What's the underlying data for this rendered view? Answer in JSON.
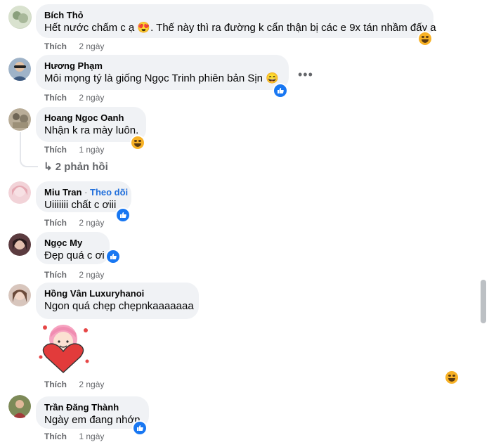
{
  "comments": [
    {
      "name": "Bích Thỏ",
      "follow": "",
      "text": "Hết nước chấm c ạ 😍. Thế này thì ra đường k cẩn thận bị các e 9x tán nhầm đấy a",
      "like": "Thích",
      "time": "2 ngày",
      "reaction": "haha"
    },
    {
      "name": "Hương Phạm",
      "follow": "",
      "text": "Môi mọng tý là giống Ngọc Trinh phiên bản Sịn 😄",
      "like": "Thích",
      "time": "2 ngày",
      "reaction": "like"
    },
    {
      "name": "Hoang Ngoc Oanh",
      "follow": "",
      "text": "Nhận k ra mày luôn.",
      "like": "Thích",
      "time": "1 ngày",
      "reaction": "haha"
    },
    {
      "name": "Miu Tran",
      "follow": "Theo dõi",
      "text": "Uiiiiiii chất c ơiii",
      "like": "Thích",
      "time": "2 ngày",
      "reaction": "like"
    },
    {
      "name": "Ngọc My",
      "follow": "",
      "text": "Đẹp quá c ơi",
      "like": "Thích",
      "time": "2 ngày",
      "reaction": "like"
    },
    {
      "name": "Hồng Vân Luxuryhanoi",
      "follow": "",
      "text": "Ngon quá chẹp chẹpnkaaaaaaa",
      "like": "Thích",
      "time": "2 ngày",
      "reaction": "haha"
    },
    {
      "name": "Trần Đăng Thành",
      "follow": "",
      "text": "Ngày em đang nhớn",
      "like": "Thích",
      "time": "1 ngày",
      "reaction": "like"
    }
  ],
  "replies_label": "↳ 2 phản hồi",
  "more_menu": "•••",
  "colors": {
    "bubble": "#f0f2f5",
    "link": "#216fdb",
    "muted": "#65676b",
    "like": "#1877f2",
    "haha": "#f7b125"
  }
}
